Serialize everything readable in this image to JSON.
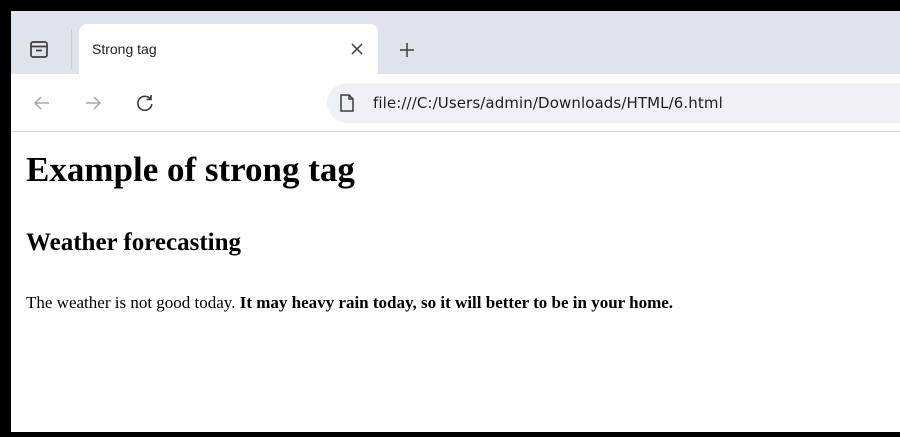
{
  "browser": {
    "tab": {
      "title": "Strong tag",
      "close_glyph": "×"
    },
    "new_tab_glyph": "+",
    "nav": {
      "back_icon": "arrow-left-icon",
      "forward_icon": "arrow-right-icon",
      "reload_icon": "reload-icon"
    },
    "address_bar": {
      "url": "file:///C:/Users/admin/Downloads/HTML/6.html",
      "icon": "page-icon"
    }
  },
  "page": {
    "heading": "Example of strong tag",
    "subheading": "Weather forecasting",
    "paragraph_normal": "The weather is not good today. ",
    "paragraph_strong": "It may heavy rain today, so it will better to be in your home."
  },
  "colors": {
    "tabstrip": "#dfe3eb",
    "omnibox": "#eef1f6",
    "frame": "#000000"
  }
}
